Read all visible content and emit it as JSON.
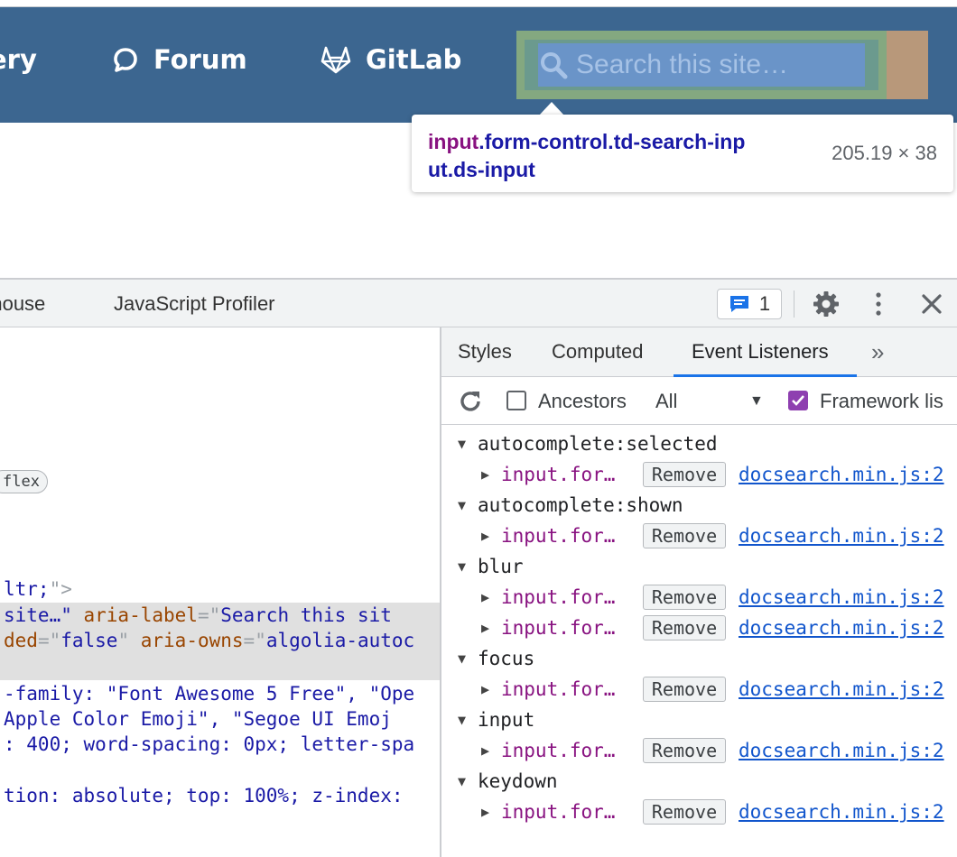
{
  "navbar": {
    "links": [
      {
        "label": "ery"
      },
      {
        "label": "Forum",
        "icon": "comment-icon"
      },
      {
        "label": "GitLab",
        "icon": "gitlab-icon"
      }
    ],
    "search_placeholder": "Search this site…",
    "colors": {
      "background": "#3c6690",
      "margin_overlay": "#84a880",
      "padding_overlay": "#6b9a8e",
      "content_overlay": "#6a94c8"
    }
  },
  "tooltip": {
    "tag": "input",
    "selector_line1": ".form-control.td-search-inp",
    "selector_line2": "ut.ds-input",
    "dimensions": "205.19 × 38"
  },
  "devtools": {
    "tabs": [
      "nthouse",
      "JavaScript Profiler"
    ],
    "issues_count": "1",
    "elements": {
      "flex_badge": "flex",
      "lines": {
        "l1_val": " ltr;",
        "l1_end": "\">",
        "l2_a": " site…\"",
        "l2_attr": " aria-label",
        "l2_eq": "=\"",
        "l2_val": "Search this sit",
        "l3_a": "ded",
        "l3_eq": "=\"",
        "l3_val": "false",
        "l3_q": "\"",
        "l3_attr": " aria-owns",
        "l3_eq2": "=\"",
        "l3_val2": "algolia-autoc",
        "s1": "-family: \"Font Awesome 5 Free\", \"Ope",
        "s2": " Apple Color Emoji\", \"Segoe UI Emoj",
        "s3": ": 400; word-spacing: 0px; letter-spa",
        "s4": "tion: absolute; top: 100%; z-index:"
      }
    },
    "sidebar": {
      "tabs": {
        "styles": "Styles",
        "computed": "Computed",
        "events": "Event Listeners",
        "more": "»"
      },
      "filter": {
        "ancestors": "Ancestors",
        "all": "All",
        "framework": "Framework lis"
      },
      "events": [
        {
          "name": "autocomplete:selected",
          "listeners": [
            {
              "node": "input.for…",
              "source": "docsearch.min.js:2"
            }
          ]
        },
        {
          "name": "autocomplete:shown",
          "listeners": [
            {
              "node": "input.for…",
              "source": "docsearch.min.js:2"
            }
          ]
        },
        {
          "name": "blur",
          "listeners": [
            {
              "node": "input.for…",
              "source": "docsearch.min.js:2"
            },
            {
              "node": "input.for…",
              "source": "docsearch.min.js:2"
            }
          ]
        },
        {
          "name": "focus",
          "listeners": [
            {
              "node": "input.for…",
              "source": "docsearch.min.js:2"
            }
          ]
        },
        {
          "name": "input",
          "listeners": [
            {
              "node": "input.for…",
              "source": "docsearch.min.js:2"
            }
          ]
        },
        {
          "name": "keydown",
          "listeners": [
            {
              "node": "input.for…",
              "source": "docsearch.min.js:2"
            }
          ]
        }
      ],
      "remove_label": "Remove"
    }
  }
}
